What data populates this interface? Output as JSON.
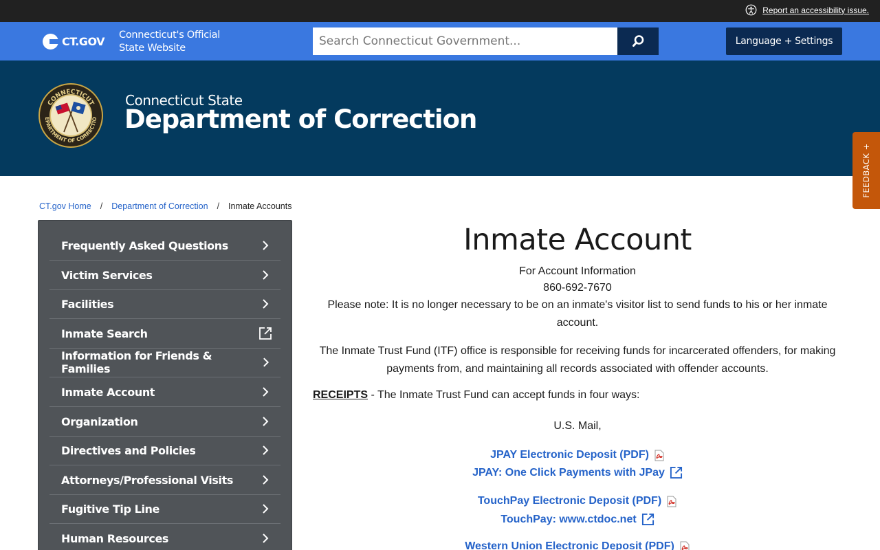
{
  "utility": {
    "accessibility_link": "Report an accessibility issue."
  },
  "ctgov": {
    "logo_text": "CT.GOV",
    "tagline": "Connecticut's Official State Website",
    "search_placeholder": "Search Connecticut Government...",
    "language_button": "Language + Settings"
  },
  "agency": {
    "subtitle": "Connecticut State",
    "title": "Department of Correction",
    "seal_lines": [
      "CONNECTICUT",
      "DEPARTMENT OF CORRECTION"
    ]
  },
  "feedback": {
    "label": "FEEDBACK +"
  },
  "breadcrumb": {
    "items": [
      "CT.gov Home",
      "Department of Correction"
    ],
    "current": "Inmate Accounts",
    "separator": "/"
  },
  "sidebar": {
    "items": [
      {
        "label": "Frequently Asked Questions",
        "icon": "chevron-right-icon"
      },
      {
        "label": "Victim Services",
        "icon": "chevron-right-icon"
      },
      {
        "label": "Facilities",
        "icon": "chevron-right-icon"
      },
      {
        "label": "Inmate Search",
        "icon": "external-link-icon"
      },
      {
        "label": "Information for Friends & Families",
        "icon": "chevron-right-icon"
      },
      {
        "label": "Inmate Account",
        "icon": "chevron-right-icon"
      },
      {
        "label": "Organization",
        "icon": "chevron-right-icon"
      },
      {
        "label": "Directives and Policies",
        "icon": "chevron-right-icon"
      },
      {
        "label": "Attorneys/Professional Visits",
        "icon": "chevron-right-icon"
      },
      {
        "label": "Fugitive Tip Line",
        "icon": "chevron-right-icon"
      },
      {
        "label": "Human Resources",
        "icon": "chevron-right-icon"
      }
    ]
  },
  "main": {
    "title": "Inmate Account",
    "account_info_label": "For Account Information",
    "phone": "860-692-7670",
    "note": "Please note: It is no longer necessary to be on an inmate's visitor list to send funds to his or her inmate account.",
    "itf_description": "The Inmate Trust Fund (ITF) office is responsible for receiving funds for incarcerated offenders, for making payments from, and maintaining all records associated with offender accounts.",
    "receipts_heading": "RECEIPTS",
    "receipts_text": " - The Inmate Trust Fund can accept funds in four ways:",
    "us_mail": "U.S. Mail,",
    "links": [
      {
        "label": "JPAY Electronic Deposit (PDF)",
        "icon": "pdf-icon"
      },
      {
        "label": "JPAY: One Click Payments with JPay",
        "icon": "external-link-icon"
      },
      {
        "label": "TouchPay Electronic Deposit (PDF)",
        "icon": "pdf-icon"
      },
      {
        "label": "TouchPay: www.ctdoc.net",
        "icon": "external-link-icon"
      },
      {
        "label": "Western Union Electronic Deposit (PDF)",
        "icon": "pdf-icon"
      }
    ]
  },
  "colors": {
    "utility_bar": "#212121",
    "ctgov_bar": "#3a78e0",
    "navy_button": "#0b2a52",
    "agency_header": "#043a5e",
    "sidebar": "#505458",
    "link": "#2563c9",
    "feedback": "#c4570a"
  }
}
